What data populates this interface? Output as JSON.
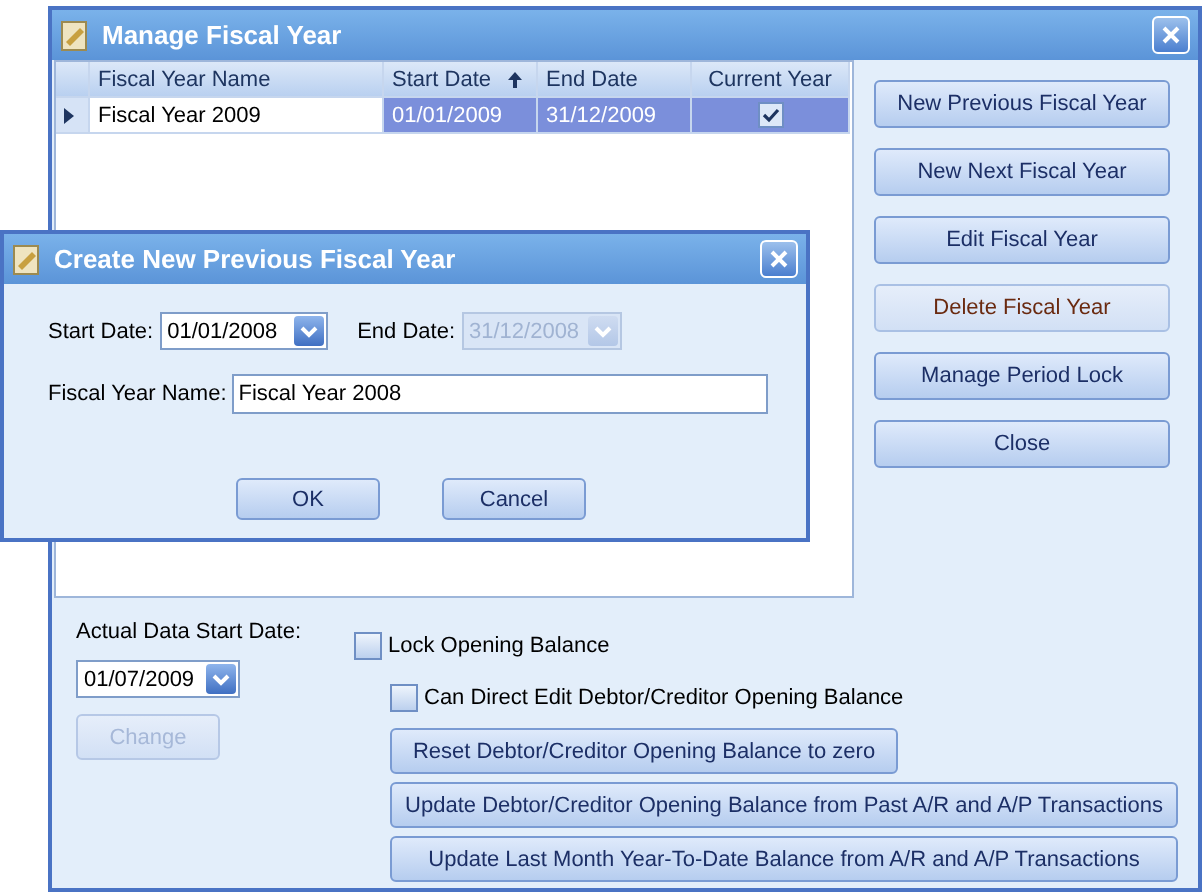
{
  "window": {
    "title": "Manage Fiscal Year"
  },
  "grid": {
    "columns": [
      {
        "label": "Fiscal Year Name",
        "sorted": false
      },
      {
        "label": "Start Date",
        "sorted": true
      },
      {
        "label": "End Date",
        "sorted": false
      },
      {
        "label": "Current Year",
        "sorted": false
      }
    ],
    "rows": [
      {
        "name": "Fiscal Year 2009",
        "start": "01/01/2009",
        "end": "31/12/2009",
        "current": true,
        "selected": true
      }
    ]
  },
  "side_buttons": [
    {
      "label": "New Previous Fiscal Year",
      "disabled": false
    },
    {
      "label": "New Next Fiscal Year",
      "disabled": false
    },
    {
      "label": "Edit Fiscal Year",
      "disabled": false
    },
    {
      "label": "Delete Fiscal Year",
      "disabled": true
    },
    {
      "label": "Manage Period Lock",
      "disabled": false
    },
    {
      "label": "Close",
      "disabled": false
    }
  ],
  "bottom": {
    "start_label": "Actual Data Start Date:",
    "start_value": "01/07/2009",
    "change_button": {
      "label": "Change",
      "disabled": true
    },
    "checkboxes": [
      {
        "label": "Lock Opening Balance",
        "checked": false
      },
      {
        "label": "Can Direct Edit Debtor/Creditor Opening Balance",
        "checked": false
      }
    ],
    "action_buttons": [
      "Reset Debtor/Creditor Opening Balance to zero",
      "Update Debtor/Creditor Opening Balance from Past A/R and A/P Transactions",
      "Update Last Month Year-To-Date Balance from A/R and A/P Transactions"
    ]
  },
  "dialog": {
    "title": "Create New Previous Fiscal Year",
    "start_label": "Start Date:",
    "start_value": "01/01/2008",
    "end_label": "End Date:",
    "end_value": "31/12/2008",
    "end_disabled": true,
    "name_label": "Fiscal Year Name:",
    "name_value": "Fiscal Year 2008",
    "buttons": [
      "OK",
      "Cancel"
    ]
  }
}
